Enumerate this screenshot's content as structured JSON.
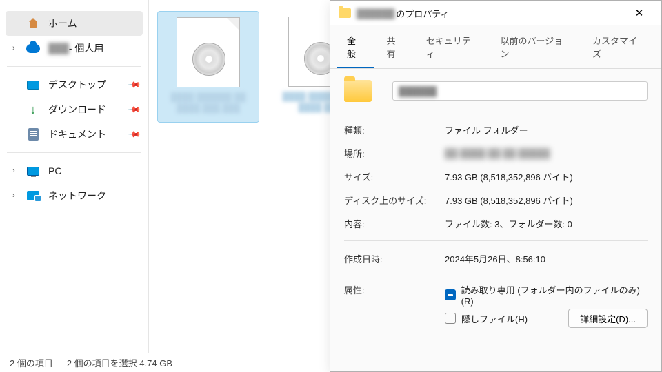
{
  "sidebar": {
    "home": "ホーム",
    "onedrive_suffix": " - 個人用",
    "desktop": "デスクトップ",
    "downloads": "ダウンロード",
    "documents": "ドキュメント",
    "pc": "PC",
    "network": "ネットワーク"
  },
  "files": {
    "item1": "████ ██████\n██ ████ ███\n███",
    "item2": "████ ██████\n██ ████ ███"
  },
  "statusbar": {
    "count": "2 個の項目",
    "selection": "2 個の項目を選択  4.74 GB"
  },
  "dialog": {
    "title_blur": "██████",
    "title_suffix": "のプロパティ",
    "tabs": {
      "general": "全般",
      "share": "共有",
      "security": "セキュリティ",
      "versions": "以前のバージョン",
      "customize": "カスタマイズ"
    },
    "name_blur": "██████",
    "labels": {
      "type": "種類:",
      "location": "場所:",
      "size": "サイズ:",
      "size_on_disk": "ディスク上のサイズ:",
      "contents": "内容:",
      "created": "作成日時:",
      "attributes": "属性:"
    },
    "values": {
      "type": "ファイル フォルダー",
      "location_blur": "██ ████ ██ ██ █████",
      "size": "7.93 GB (8,518,352,896 バイト)",
      "size_on_disk": "7.93 GB (8,518,352,896 バイト)",
      "contents": "ファイル数: 3、フォルダー数: 0",
      "created": "2024年5月26日、8:56:10"
    },
    "attr_readonly": "読み取り専用 (フォルダー内のファイルのみ)(R)",
    "attr_hidden": "隠しファイル(H)",
    "btn_advanced": "詳細設定(D)..."
  }
}
